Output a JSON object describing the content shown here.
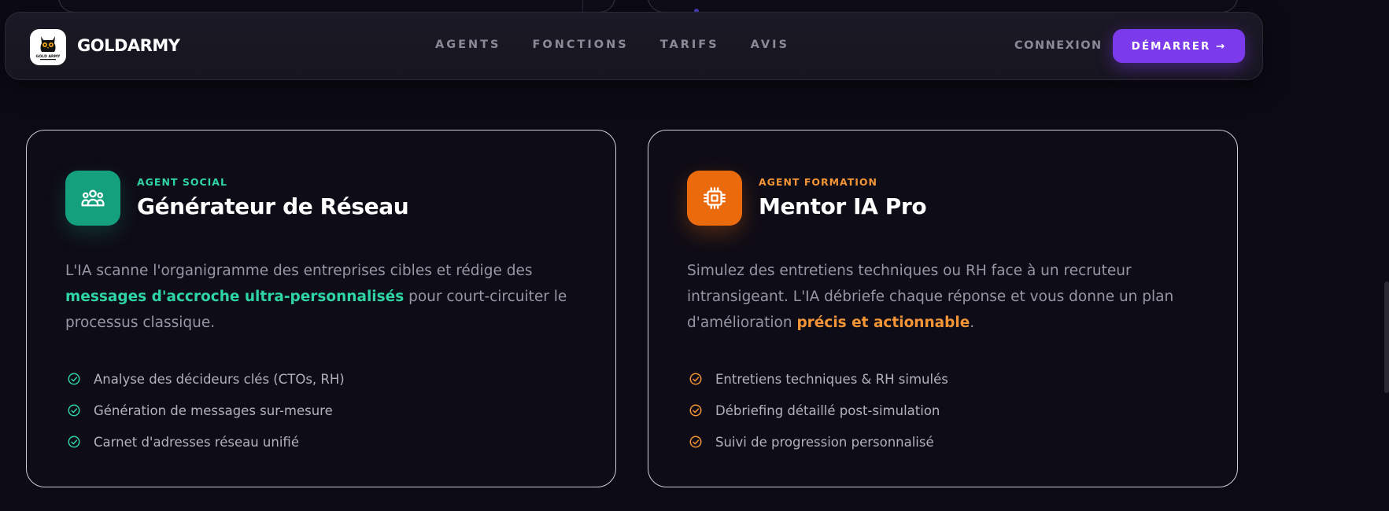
{
  "brand": {
    "name": "GOLDARMY",
    "logo_text": "GOLD ARMY",
    "logo_icon": "owl-logo-icon"
  },
  "nav": {
    "links": [
      {
        "label": "AGENTS"
      },
      {
        "label": "FONCTIONS"
      },
      {
        "label": "TARIFS"
      },
      {
        "label": "AVIS"
      }
    ],
    "login_label": "CONNEXION",
    "cta_label": "DÉMARRER →",
    "cta_color": "#7c3aed"
  },
  "cards": [
    {
      "icon": "users-icon",
      "accent_color": "#2fd4a3",
      "icon_bg": "#14a07d",
      "kicker": "AGENT SOCIAL",
      "title": "Générateur de Réseau",
      "desc_before": "L'IA scanne l'organigramme des entreprises cibles et rédige des ",
      "desc_highlight": "messages d'accroche ultra-personnalisés",
      "desc_after": " pour court-circuiter le processus classique.",
      "features": [
        "Analyse des décideurs clés (CTOs, RH)",
        "Génération de messages sur-mesure",
        "Carnet d'adresses réseau unifié"
      ]
    },
    {
      "icon": "cpu-chip-icon",
      "accent_color": "#f39436",
      "icon_bg": "#ea6a0c",
      "kicker": "AGENT FORMATION",
      "title": "Mentor IA Pro",
      "desc_before": "Simulez des entretiens techniques ou RH face à un recruteur intransigeant. L'IA débriefe chaque réponse et vous donne un plan d'amélioration ",
      "desc_highlight": "précis et actionnable",
      "desc_after": ".",
      "features": [
        "Entretiens techniques & RH simulés",
        "Débriefing détaillé post-simulation",
        "Suivi de progression personnalisé"
      ]
    }
  ]
}
